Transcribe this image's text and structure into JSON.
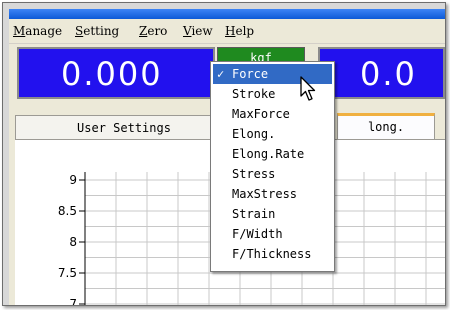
{
  "menubar": {
    "items": [
      {
        "label": "Manage",
        "mnemonic": "M",
        "rest": "anage"
      },
      {
        "label": "Setting",
        "mnemonic": "S",
        "rest": "etting"
      },
      {
        "label": "Zero",
        "mnemonic": "Z",
        "rest": "ero"
      },
      {
        "label": "View",
        "mnemonic": "V",
        "rest": "iew"
      },
      {
        "label": "Help",
        "mnemonic": "H",
        "rest": "elp"
      }
    ]
  },
  "display": {
    "left_value": "0.000",
    "right_value": "0.0",
    "unit": "kgf"
  },
  "tabs": {
    "user_settings": "User Settings",
    "elong": "long."
  },
  "dropdown": {
    "check_mark": "✓",
    "selected_index": 0,
    "items": [
      "Force",
      "Stroke",
      "MaxForce",
      "Elong.",
      "Elong.Rate",
      "Stress",
      "MaxStress",
      "Strain",
      "F/Width",
      "F/Thickness"
    ]
  },
  "chart_data": {
    "type": "line",
    "yticks": [
      "9",
      "8.5",
      "8",
      "7.5",
      "7"
    ],
    "yvalues": [
      9,
      8.5,
      8,
      7.5,
      7
    ],
    "grid": true,
    "series": []
  },
  "colors": {
    "display_bg": "#2211ee",
    "unit_bg": "#1f8a1f",
    "selection": "#316ac5",
    "active_tab_accent": "#f0b040"
  }
}
